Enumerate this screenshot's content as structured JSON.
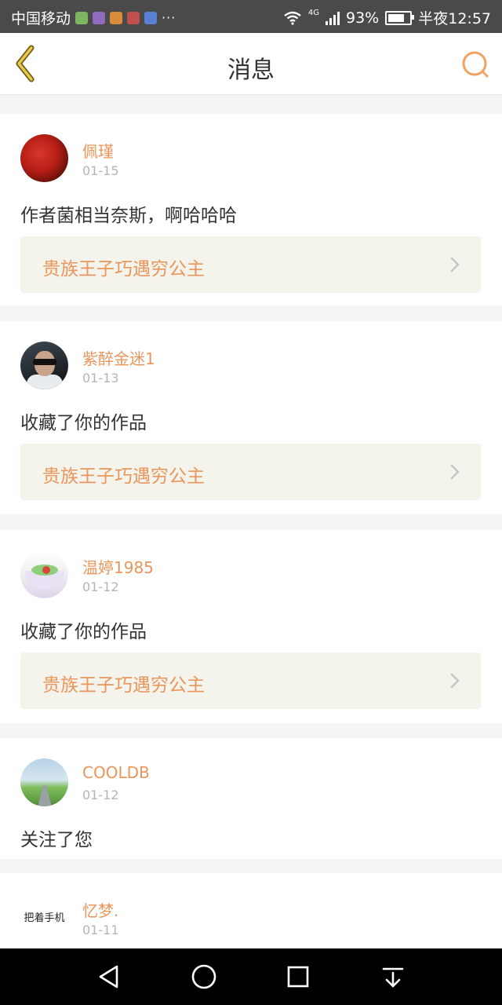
{
  "status_bar": {
    "carrier": "中国移动",
    "more": "···",
    "network": "4G",
    "battery": "93%",
    "time": "半夜12:57"
  },
  "header": {
    "title": "消息"
  },
  "messages": [
    {
      "user": "佩瑾",
      "date": "01-15",
      "text": "作者菌相当奈斯，啊哈哈哈",
      "work": "贵族王子巧遇穷公主"
    },
    {
      "user": "紫醉金迷1",
      "date": "01-13",
      "text": "收藏了你的作品",
      "work": "贵族王子巧遇穷公主"
    },
    {
      "user": "温婷1985",
      "date": "01-12",
      "text": "收藏了你的作品",
      "work": "贵族王子巧遇穷公主"
    },
    {
      "user": "COOLDB",
      "date": "01-12",
      "text": "关注了您"
    },
    {
      "user": "忆梦.",
      "date": "01-11",
      "avatar_text": "把着手机"
    }
  ],
  "colors": {
    "accent": "#e8965b",
    "status_bar": "#4a4a4a",
    "work_link_bg": "#f4f3ec"
  }
}
